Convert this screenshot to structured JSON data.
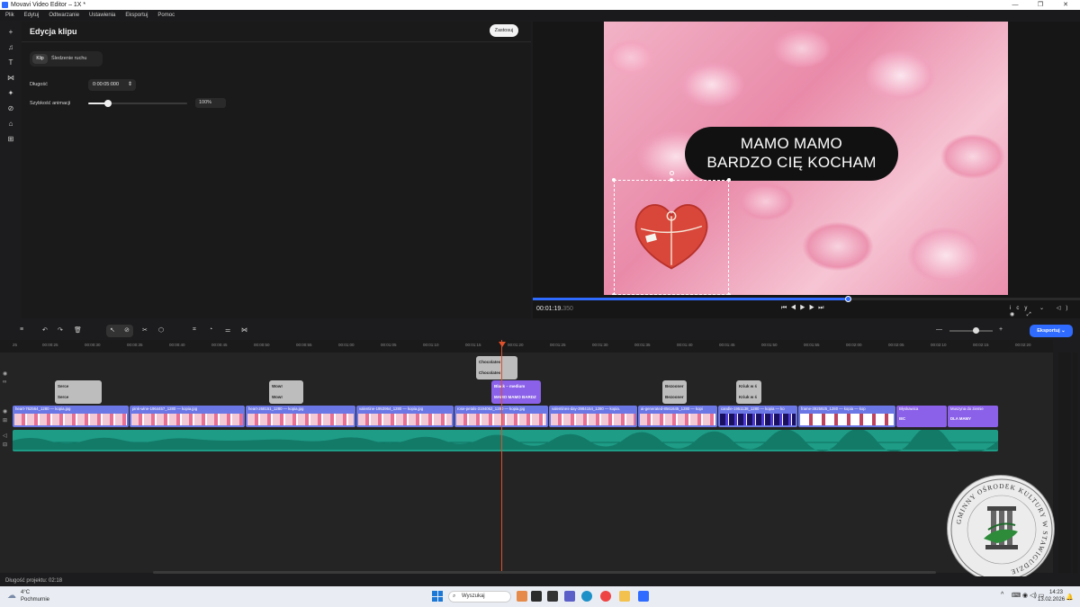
{
  "window": {
    "title": "Movavi Video Editor – 1X *",
    "minimize": "—",
    "maximize": "❐",
    "close": "✕"
  },
  "menu": [
    "Plik",
    "Edytuj",
    "Odtwarzanie",
    "Ustawienia",
    "Eksportuj",
    "Pomoc"
  ],
  "left_tools": [
    "add-icon",
    "music-icon",
    "text-icon",
    "transitions-icon",
    "magic-icon",
    "filter-icon",
    "sticker-icon",
    "more-icon"
  ],
  "props": {
    "title": "Edycja klipu",
    "apply": "Zastosuj",
    "tabs": [
      "Klip",
      "Śledzenie ruchu"
    ],
    "duration_label": "Długość",
    "duration_value": "0:00:05:000",
    "anim_label": "Szybkość animacji",
    "anim_value": "100%",
    "anim_fraction": 0.2
  },
  "viewer": {
    "caption_line1": "MAMO MAMO",
    "caption_line2": "BARDZO CIĘ KOCHAM",
    "time": "00:01:19.",
    "time_ms": "350",
    "progress": 0.575,
    "fit": "icy ⌄"
  },
  "timeline": {
    "export": "Eksportuj",
    "ruler": [
      "25",
      "00:00:25",
      "00:00:30",
      "00:00:35",
      "00:00:40",
      "00:00:45",
      "00:00:50",
      "00:00:55",
      "00:01:00",
      "00:01:05",
      "00:01:10",
      "00:01:15",
      "00:01:20",
      "00:01:25",
      "00:01:30",
      "00:01:35",
      "00:01:40",
      "00:01:45",
      "00:01:50",
      "00:01:55",
      "00:02:00",
      "00:02:05",
      "00:02:10",
      "00:02:15",
      "00:02:20"
    ],
    "text_clips": [
      {
        "a": "Serce",
        "b": "Serce"
      },
      {
        "a": "Wow!",
        "b": "Wow!"
      },
      {
        "a": "Chocolates",
        "b": "Chocolates"
      },
      {
        "a": "Black – medium",
        "b": "MAMO MAMO BARDZ"
      },
      {
        "a": "Bezooner",
        "b": "Bezooner"
      },
      {
        "a": "Kriuk w ś",
        "b": "Kriuk w ś"
      }
    ],
    "video_clips": [
      "heart-762564_1280 — kopia.jpg",
      "pink-wine-1964457_1280 — kopia.jpg",
      "heart-268151_1280 — kopia.jpg",
      "valentine-1953964_1280 — kopia.jpg",
      "rose-petals-3194062_1280 — kopia.jpg",
      "valentines-day-3984154_1280 — kopia.",
      "ai-generated-8561645_1280 — kopi",
      "candle-1951138_1280 — kopia — ko",
      "frame-3925925_1280 — kopia — kop",
      "Błyskawica",
      "Muszyna do ziemie"
    ],
    "video_subs": [
      "IEC",
      "DLA MAMY"
    ],
    "project_length": "Długość projektu: 02:18"
  },
  "seal": {
    "text": "GMINNY OŚRODEK KULTURY W STAWIGUDZIE"
  },
  "taskbar": {
    "temp": "4°C",
    "weather": "Pochmurnie",
    "search": "Wyszukaj",
    "time": "14:23",
    "date": "13.02.2026"
  }
}
